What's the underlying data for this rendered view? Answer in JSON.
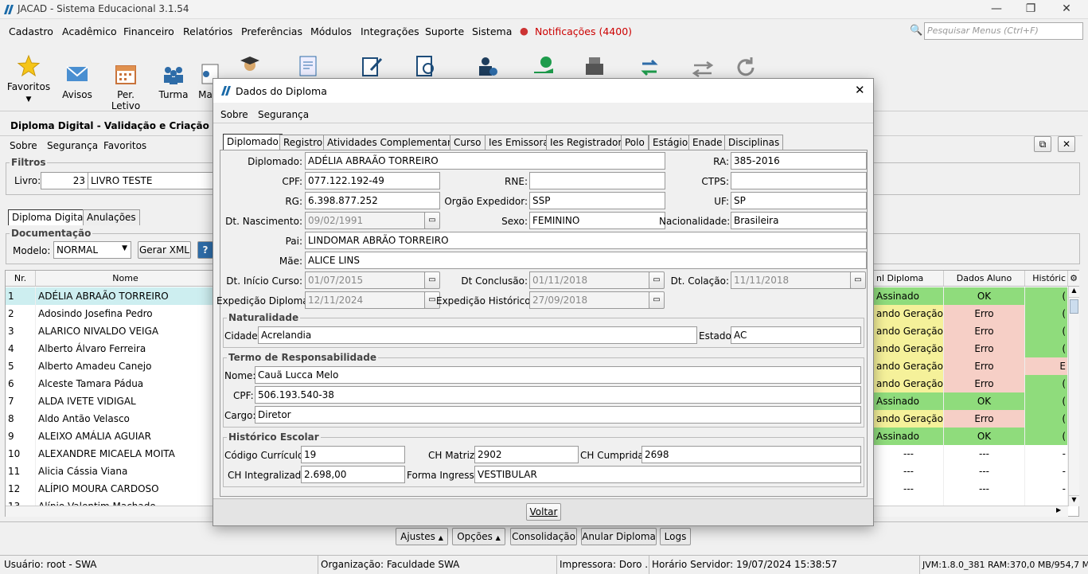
{
  "window": {
    "title": "JACAD - Sistema Educacional 3.1.54"
  },
  "menu": {
    "items": [
      "Cadastro",
      "Acadêmico",
      "Financeiro",
      "Relatórios",
      "Preferências",
      "Módulos",
      "Integrações",
      "Suporte",
      "Sistema"
    ],
    "notifications": "Notificações (4400)",
    "search_placeholder": "Pesquisar Menus (Ctrl+F)"
  },
  "toolbar": {
    "items": [
      "Favoritos",
      "Avisos",
      "Per. Letivo",
      "Turma",
      "Ma"
    ]
  },
  "panel": {
    "title": "Diploma Digital - Validação e Criação do XML",
    "menu": [
      "Sobre",
      "Segurança",
      "Favoritos"
    ],
    "filters": {
      "legend": "Filtros",
      "livro_label": "Livro:",
      "livro_num": "23",
      "livro_name": "LIVRO TESTE"
    },
    "tabs": [
      "Diploma Digital",
      "Anulações"
    ],
    "doc": {
      "legend": "Documentação",
      "modelo_label": "Modelo:",
      "modelo_value": "NORMAL",
      "gerar": "Gerar XML"
    },
    "grid": {
      "headers": {
        "nr": "Nr.",
        "nome": "Nome",
        "diploma": "nl Diploma",
        "dados": "Dados Aluno",
        "hist": "Históric"
      },
      "rows": [
        {
          "nr": "1",
          "nome": "ADÉLIA ABRAÃO TORREIRO",
          "dip": "Assinado",
          "dados": "OK",
          "hist": "("
        },
        {
          "nr": "2",
          "nome": "Adosindo Josefina Pedro",
          "dip": "ando Geração/...",
          "dados": "Erro",
          "hist": "("
        },
        {
          "nr": "3",
          "nome": "ALARICO NIVALDO VEIGA",
          "dip": "ando Geração/...",
          "dados": "Erro",
          "hist": "("
        },
        {
          "nr": "4",
          "nome": "Alberto Álvaro Ferreira",
          "dip": "ando Geração/...",
          "dados": "Erro",
          "hist": "("
        },
        {
          "nr": "5",
          "nome": "Alberto Amadeu Canejo",
          "dip": "ando Geração/...",
          "dados": "Erro",
          "hist": "E"
        },
        {
          "nr": "6",
          "nome": "Alceste Tamara Pádua",
          "dip": "ando Geração/...",
          "dados": "Erro",
          "hist": "("
        },
        {
          "nr": "7",
          "nome": "ALDA IVETE VIDIGAL",
          "dip": "Assinado",
          "dados": "OK",
          "hist": "("
        },
        {
          "nr": "8",
          "nome": "Aldo Antão Velasco",
          "dip": "ando Geração/...",
          "dados": "Erro",
          "hist": "("
        },
        {
          "nr": "9",
          "nome": "ALEIXO AMÁLIA AGUIAR",
          "dip": "Assinado",
          "dados": "OK",
          "hist": "("
        },
        {
          "nr": "10",
          "nome": "ALEXANDRE MICAELA MOITA",
          "dip": "---",
          "dados": "---",
          "hist": "-"
        },
        {
          "nr": "11",
          "nome": "Alicia Cássia Viana",
          "dip": "---",
          "dados": "---",
          "hist": "-"
        },
        {
          "nr": "12",
          "nome": "ALÍPIO MOURA CARDOSO",
          "dip": "---",
          "dados": "---",
          "hist": "-"
        },
        {
          "nr": "13",
          "nome": "Alípio Valentim Machado",
          "dip": "",
          "dados": "",
          "hist": ""
        }
      ]
    },
    "buttons": [
      "Ajustes",
      "Opções",
      "Consolidação",
      "Anular Diploma",
      "Logs"
    ]
  },
  "dialog": {
    "title": "Dados do Diploma",
    "menu": [
      "Sobre",
      "Segurança"
    ],
    "tabs": [
      "Diplomado",
      "Registro",
      "Atividades Complementares",
      "Curso",
      "Ies Emissora",
      "Ies Registradora",
      "Polo",
      "Estágio",
      "Enade",
      "Disciplinas"
    ],
    "labels": {
      "diplomado": "Diplomado:",
      "ra": "RA:",
      "cpf": "CPF:",
      "rne": "RNE:",
      "ctps": "CTPS:",
      "rg": "RG:",
      "orgao": "Orgão Expedidor:",
      "uf": "UF:",
      "nasc": "Dt. Nascimento:",
      "sexo": "Sexo:",
      "nac": "Nacionalidade:",
      "pai": "Pai:",
      "mae": "Mãe:",
      "inicio": "Dt. Início Curso:",
      "conclusao": "Dt Conclusão:",
      "colacao": "Dt. Colação:",
      "expdip": "Expedição Diploma:",
      "exphist": "Expedição Histórico:"
    },
    "values": {
      "diplomado": "ADÉLIA ABRAÃO TORREIRO",
      "ra": "385-2016",
      "cpf": "077.122.192-49",
      "rne": "",
      "ctps": "",
      "rg": "6.398.877.252",
      "orgao": "SSP",
      "uf": "SP",
      "nasc": "09/02/1991",
      "sexo": "FEMININO",
      "nac": "Brasileira",
      "pai": "LINDOMAR ABRÃO TORREIRO",
      "mae": "ALICE LINS",
      "inicio": "01/07/2015",
      "conclusao": "01/11/2018",
      "colacao": "11/11/2018",
      "expdip": "12/11/2024",
      "exphist": "27/09/2018"
    },
    "naturalidade": {
      "legend": "Naturalidade",
      "cidade_label": "Cidade:",
      "cidade": "Acrelandia",
      "estado_label": "Estado:",
      "estado": "AC"
    },
    "termo": {
      "legend": "Termo de Responsabilidade",
      "nome_label": "Nome:",
      "nome": "Cauã Lucca Melo",
      "cpf_label": "CPF:",
      "cpf": "506.193.540-38",
      "cargo_label": "Cargo:",
      "cargo": "Diretor"
    },
    "historico": {
      "legend": "Histórico Escolar",
      "cod_label": "Código Currículo:",
      "cod": "19",
      "chm_label": "CH Matriz:",
      "chm": "2902",
      "chc_label": "CH Cumprida:",
      "chc": "2698",
      "chi_label": "CH Integralizada:",
      "chi": "2.698,00",
      "forma_label": "Forma Ingresso:",
      "forma": "VESTIBULAR"
    },
    "voltar": "Voltar"
  },
  "status": {
    "usuario": "Usuário: root - SWA",
    "org": "Organização: Faculdade SWA",
    "impressora": "Impressora: Doro ...",
    "horario": "Horário Servidor: 19/07/2024 15:38:57",
    "jvm": "JVM:1.8.0_381  RAM:370,0 MB/954,7 MB"
  },
  "colors": {
    "ok_bg": "#8fdc7c",
    "warn_bg": "#f5f19a",
    "err_bg": "#f6cfc6",
    "selected": "#cdeef0"
  }
}
